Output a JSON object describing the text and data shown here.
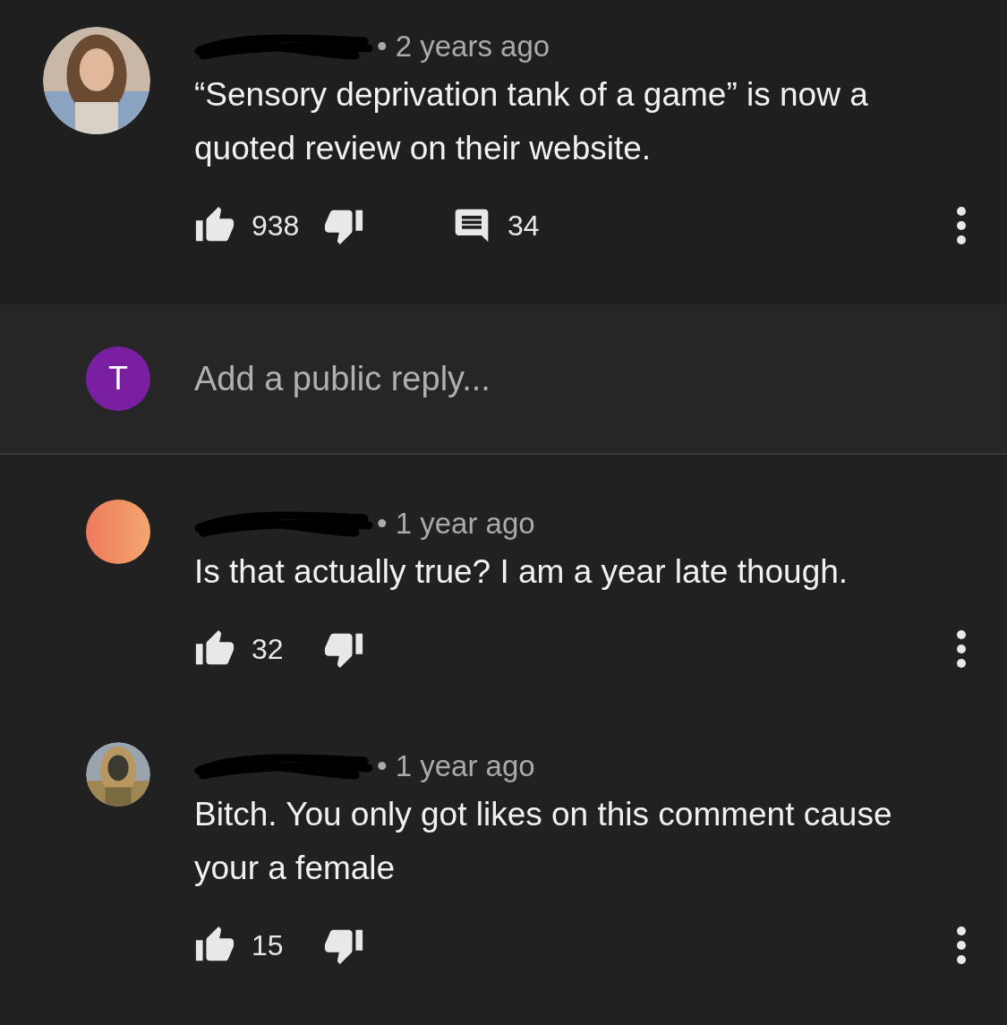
{
  "comment": {
    "time": "• 2 years ago",
    "text": "“Sensory deprivation tank of a game” is now a quoted review on their website.",
    "likes": "938",
    "replies": "34"
  },
  "reply_box": {
    "avatar_letter": "T",
    "placeholder": "Add a public reply..."
  },
  "replies": [
    {
      "avatar": {
        "kind": "gradient"
      },
      "time": "• 1 year ago",
      "text": "Is that actually true? I am a year late though.",
      "likes": "32"
    },
    {
      "time": "• 1 year ago",
      "text": "Bitch. You only got likes on this comment cause your a female",
      "likes": "15"
    }
  ]
}
